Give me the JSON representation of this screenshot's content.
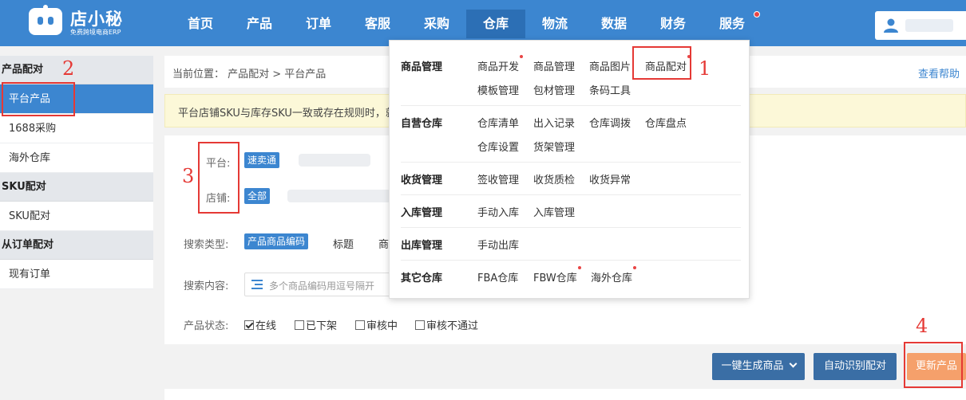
{
  "brand": {
    "name": "店小秘",
    "subtitle": "免费跨境电商ERP"
  },
  "nav": {
    "items": [
      {
        "label": "首页"
      },
      {
        "label": "产品"
      },
      {
        "label": "订单"
      },
      {
        "label": "客服"
      },
      {
        "label": "采购"
      },
      {
        "label": "仓库",
        "active": true
      },
      {
        "label": "物流"
      },
      {
        "label": "数据"
      },
      {
        "label": "财务"
      },
      {
        "label": "服务",
        "badge": true
      }
    ]
  },
  "sidebar": {
    "groups": [
      {
        "title": "产品配对",
        "items": [
          "平台产品",
          "1688采购",
          "海外仓库"
        ]
      },
      {
        "title": "SKU配对",
        "items": [
          "SKU配对"
        ]
      },
      {
        "title": "从订单配对",
        "items": [
          "现有订单"
        ]
      }
    ]
  },
  "breadcrumb": {
    "text": "当前位置： 产品配对 > 平台产品",
    "help": "查看帮助"
  },
  "notice": {
    "text": "平台店铺SKU与库存SKU一致或存在规则时，就"
  },
  "filters": {
    "platform_label": "平台:",
    "platform_value": "速卖通",
    "store_label": "店铺:",
    "store_value": "全部",
    "search_type_label": "搜索类型:",
    "search_type_selected": "产品商品编码",
    "search_type_options": [
      "标题",
      "商"
    ],
    "search_content_label": "搜索内容:",
    "search_placeholder": "多个商品编码用逗号隔开",
    "status_label": "产品状态:",
    "status_options": [
      {
        "label": "在线",
        "checked": true
      },
      {
        "label": "已下架",
        "checked": false
      },
      {
        "label": "审核中",
        "checked": false
      },
      {
        "label": "审核不通过",
        "checked": false
      }
    ]
  },
  "actions": {
    "generate": "一键生成商品",
    "auto_match": "自动识别配对",
    "update": "更新产品"
  },
  "dropdown": {
    "rows": [
      {
        "category": "商品管理",
        "links": [
          "商品开发",
          "商品管理",
          "商品图片",
          "商品配对",
          "模板管理",
          "包材管理",
          "条码工具"
        ]
      },
      {
        "category": "自营仓库",
        "links": [
          "仓库清单",
          "出入记录",
          "仓库调拨",
          "仓库盘点",
          "仓库设置",
          "货架管理"
        ]
      },
      {
        "category": "收货管理",
        "links": [
          "签收管理",
          "收货质检",
          "收货异常"
        ]
      },
      {
        "category": "入库管理",
        "links": [
          "手动入库",
          "入库管理"
        ]
      },
      {
        "category": "出库管理",
        "links": [
          "手动出库"
        ]
      },
      {
        "category": "其它仓库",
        "links": [
          "FBA仓库",
          "FBW仓库",
          "海外仓库"
        ]
      }
    ]
  },
  "annotations": [
    "1",
    "2",
    "3",
    "4"
  ],
  "colors": {
    "primary": "#3c86d0",
    "accent_orange": "#f5a06b",
    "annotation_red": "#e53935",
    "notice_bg": "#fcf8d8"
  }
}
